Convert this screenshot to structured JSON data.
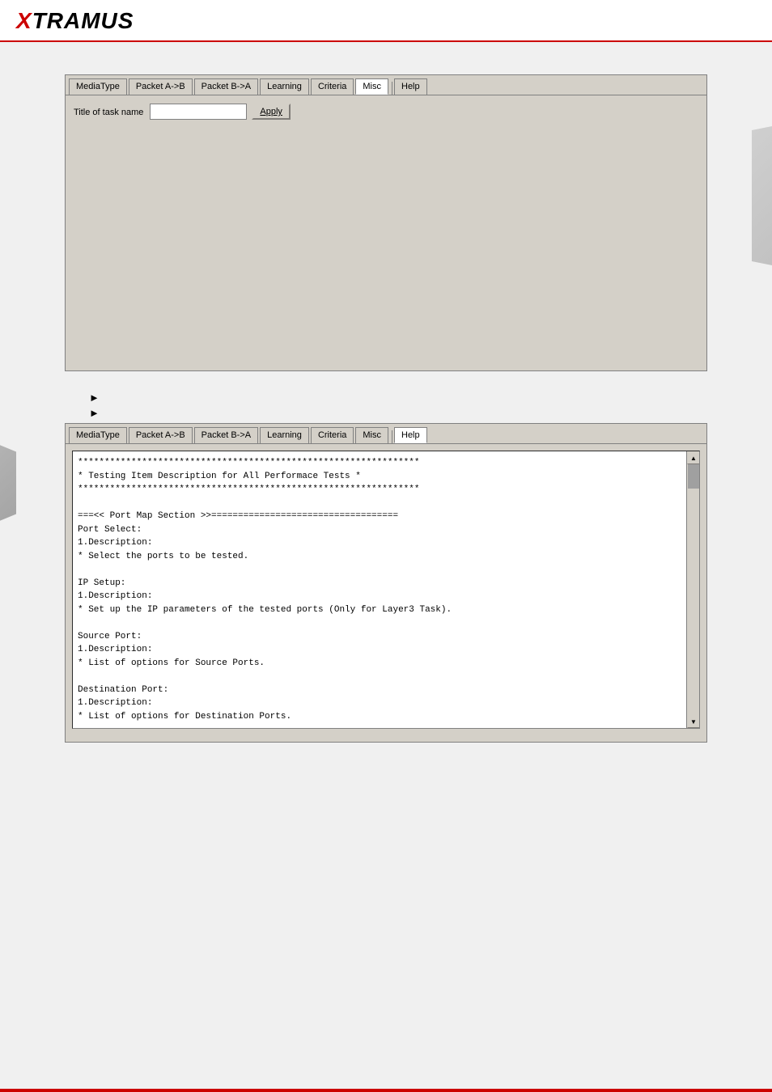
{
  "header": {
    "logo_x": "X",
    "logo_rest": "TRAMUS"
  },
  "top_panel": {
    "tabs": [
      {
        "id": "mediatype",
        "label": "MediaType",
        "active": false
      },
      {
        "id": "packet_ab",
        "label": "Packet A->B",
        "active": false
      },
      {
        "id": "packet_ba",
        "label": "Packet B->A",
        "active": false
      },
      {
        "id": "learning",
        "label": "Learning",
        "active": false
      },
      {
        "id": "criteria",
        "label": "Criteria",
        "active": false
      },
      {
        "id": "misc",
        "label": "Misc",
        "active": true
      },
      {
        "id": "help",
        "label": "Help",
        "active": false
      }
    ],
    "task_name_label": "Title of task name",
    "task_name_value": "",
    "apply_button": "Apply"
  },
  "arrows": [
    {
      "symbol": "➤"
    },
    {
      "symbol": "➤"
    }
  ],
  "bottom_panel": {
    "tabs": [
      {
        "id": "mediatype",
        "label": "MediaType",
        "active": false
      },
      {
        "id": "packet_ab",
        "label": "Packet A->B",
        "active": false
      },
      {
        "id": "packet_ba",
        "label": "Packet B->A",
        "active": false
      },
      {
        "id": "learning",
        "label": "Learning",
        "active": false
      },
      {
        "id": "criteria",
        "label": "Criteria",
        "active": false
      },
      {
        "id": "misc",
        "label": "Misc",
        "active": false
      },
      {
        "id": "help",
        "label": "Help",
        "active": true
      }
    ],
    "help_content": {
      "header_stars": "****************************************************************",
      "title_line": "*          Testing Item Description for All Performace Tests          *",
      "footer_stars": "****************************************************************",
      "separator": "===<< Port Map Section >>===================================",
      "sections": [
        {
          "title": "Port Select:",
          "desc_header": "1.Description:",
          "desc_text": "   * Select the ports to be tested."
        },
        {
          "title": "IP Setup:",
          "desc_header": "1.Description:",
          "desc_text": "   * Set up the IP parameters of the tested ports (Only for Layer3 Task)."
        },
        {
          "title": "Source Port:",
          "desc_header": "1.Description:",
          "desc_text": "   * List of options for Source Ports."
        },
        {
          "title": "Destination Port:",
          "desc_header": "1.Description:",
          "desc_text": "   * List of options for Destination Ports."
        }
      ]
    }
  }
}
